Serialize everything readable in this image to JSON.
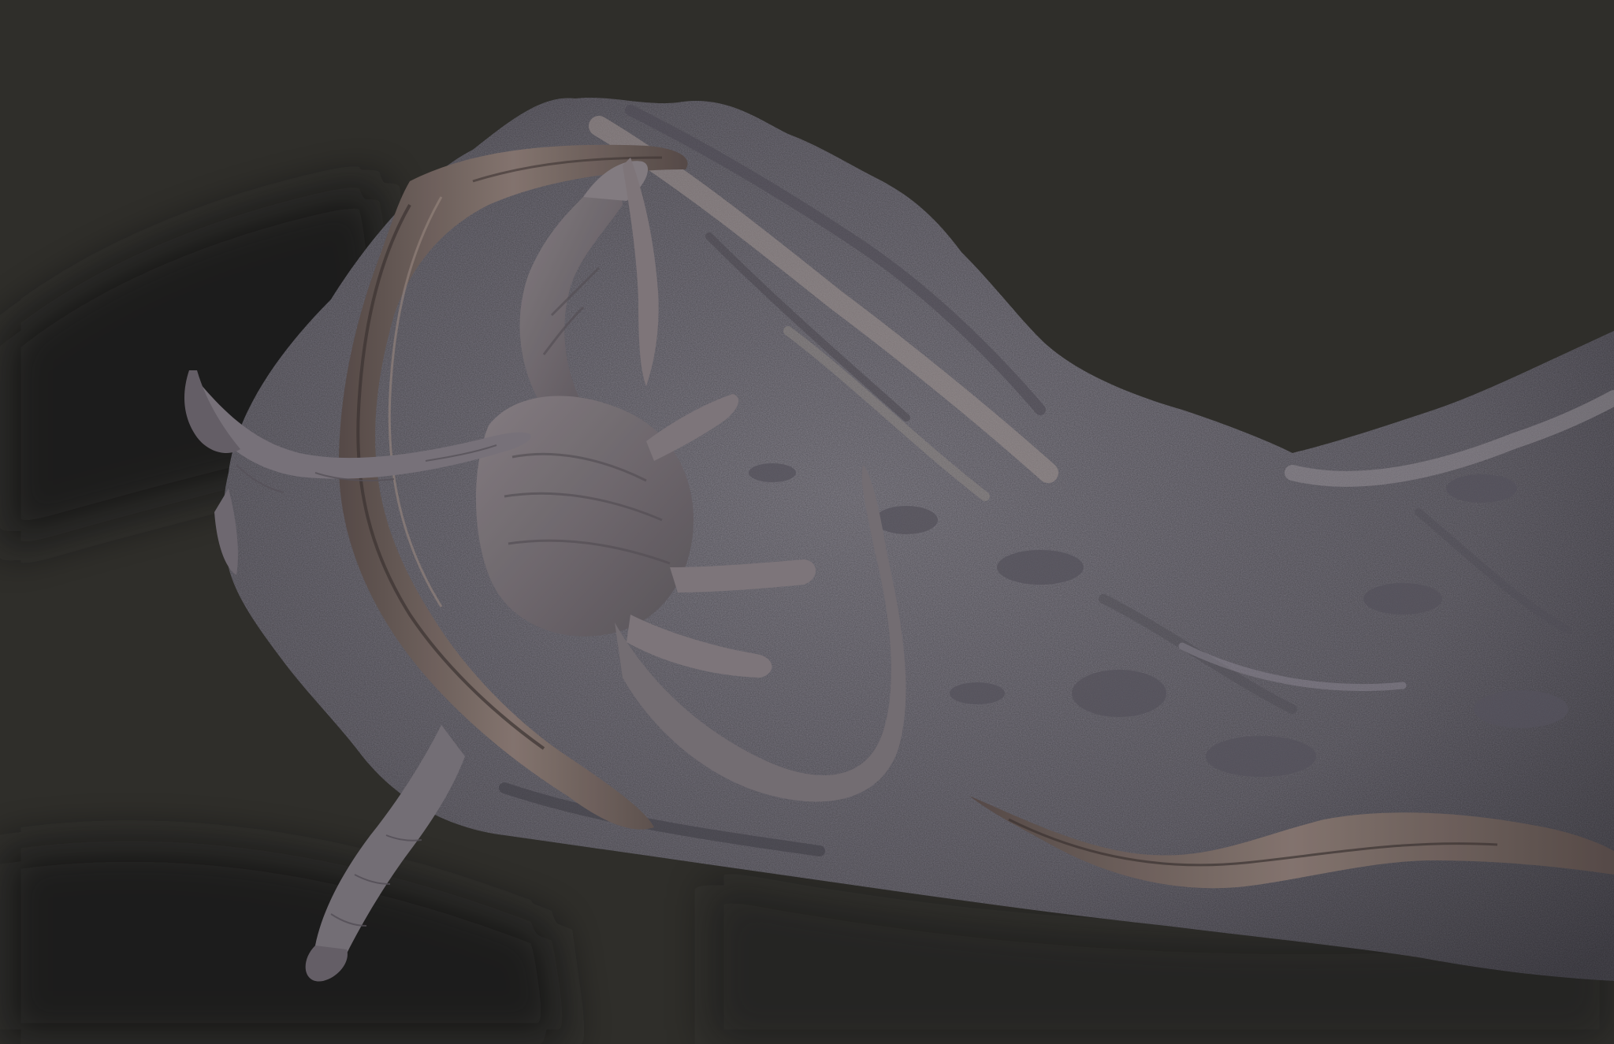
{
  "scene": {
    "subject": "sculpted-diorama",
    "colors": {
      "background": "#32312d",
      "shadow": "#24231f",
      "rock_light": "#8e8b95",
      "rock_mid": "#6f6c76",
      "rock_dark": "#4a4850",
      "wood": "#7a6c68",
      "wood_dark": "#4e4442",
      "creature": "#817a80",
      "creature_dark": "#5a545a"
    }
  }
}
